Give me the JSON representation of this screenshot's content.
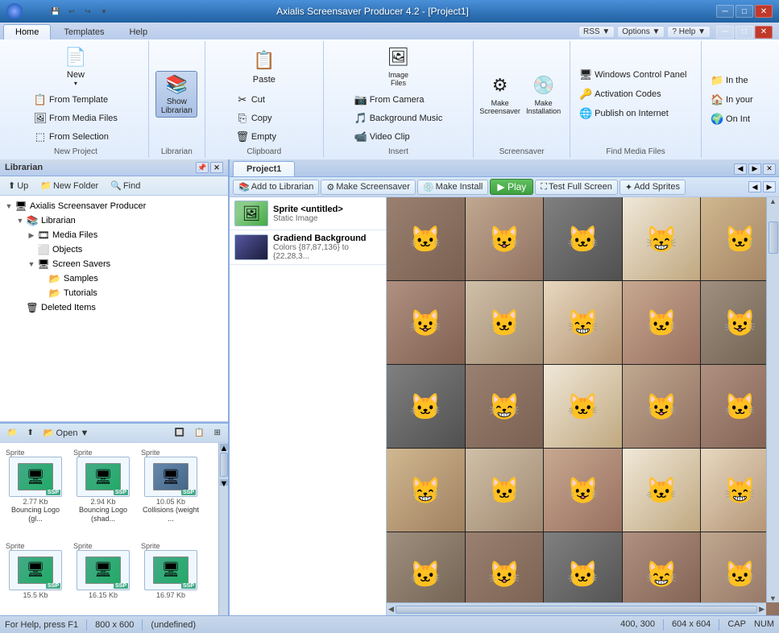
{
  "app": {
    "title": "Axialis Screensaver Producer 4.2 - [Project1]",
    "icon": "●"
  },
  "titlebar": {
    "minimize": "─",
    "restore": "□",
    "close": "✕",
    "title": "Axialis Screensaver Producer 4.2 - [Project1]"
  },
  "quick_toolbar": {
    "buttons": [
      "💾",
      "↩",
      "↪"
    ]
  },
  "ribbon": {
    "tabs": [
      "Home",
      "Templates",
      "Help"
    ],
    "active_tab": "Home",
    "groups": {
      "new_project": {
        "label": "New Project",
        "new_label": "New",
        "from_template": "From Template",
        "from_media": "From Media Files",
        "from_selection": "From Selection"
      },
      "librarian": {
        "label": "Librarian",
        "show_librarian": "Show\nLibrarian"
      },
      "clipboard": {
        "label": "Clipboard",
        "paste": "Paste",
        "cut": "Cut",
        "copy": "Copy",
        "empty": "Empty"
      },
      "insert": {
        "label": "Insert",
        "image_files": "Image\nFiles",
        "from_camera": "From Camera",
        "background_music": "Background Music",
        "video_clip": "Video Clip"
      },
      "make": {
        "label": "Screensaver",
        "make_screensaver": "Make\nScreensaver",
        "make_installation": "Make\nInstallation"
      },
      "find_media": {
        "label": "Find Media Files",
        "windows_control_panel": "Windows Control Panel",
        "activation_codes": "Activation Codes",
        "publish_on_internet": "Publish on Internet",
        "in_the": "In the",
        "in_your": "In your",
        "on_int": "On Int"
      }
    }
  },
  "top_extra": {
    "rss": "RSS ▼",
    "options": "Options ▼",
    "help": "? Help ▼",
    "min": "─",
    "restore": "□",
    "close": "✕"
  },
  "librarian_panel": {
    "title": "Librarian",
    "up_label": "Up",
    "new_folder_label": "New Folder",
    "find_label": "Find",
    "tree": {
      "root": "Axialis Screensaver Producer",
      "children": [
        {
          "label": "Librarian",
          "expanded": true,
          "children": [
            {
              "label": "Media Files",
              "children": []
            },
            {
              "label": "Objects",
              "children": []
            },
            {
              "label": "Screen Savers",
              "expanded": true,
              "children": [
                {
                  "label": "Samples",
                  "children": []
                },
                {
                  "label": "Tutorials",
                  "children": []
                }
              ]
            }
          ]
        },
        {
          "label": "Deleted Items",
          "children": []
        }
      ]
    }
  },
  "files_panel": {
    "buttons": [
      "📁",
      "🔼",
      "📂 Open ▼",
      "🔲",
      "📋",
      "⊞"
    ],
    "open_label": "Open ▼",
    "items": [
      {
        "type": "Sprite",
        "size": "2.77 Kb",
        "name": "Bouncing Logo (gl...",
        "badge": "SSP"
      },
      {
        "type": "Sprite",
        "size": "2.94 Kb",
        "name": "Bouncing Logo (shad...",
        "badge": "SSP"
      },
      {
        "type": "Sprite",
        "size": "10.05 Kb",
        "name": "Collisions (weight ...",
        "badge": "SSP"
      },
      {
        "type": "Sprite",
        "size": "15.5 Kb",
        "name": "",
        "badge": "SSP"
      },
      {
        "type": "Sprite",
        "size": "16.15 Kb",
        "name": "",
        "badge": "SSP"
      },
      {
        "type": "Sprite",
        "size": "16.97 Kb",
        "name": "",
        "badge": "SSP"
      }
    ]
  },
  "project": {
    "tab_name": "Project1",
    "toolbar": {
      "add_to_librarian": "Add to Librarian",
      "make_screensaver": "Make Screensaver",
      "make_install": "Make Install",
      "play": "▶ Play",
      "test_full_screen": "Test Full Screen",
      "add_sprites": "Add Sprites"
    },
    "sprites": [
      {
        "name": "Sprite <untitled>",
        "type": "Static Image",
        "thumb_type": "image"
      },
      {
        "name": "Gradiend Background",
        "type": "Colors {87,87,136} to {22,28,3...",
        "thumb_type": "gradient"
      }
    ]
  },
  "statusbar": {
    "help": "For Help, press F1",
    "dimensions": "800 x 600",
    "undefined": "(undefined)",
    "coords": "400, 300",
    "size2": "604 x 604",
    "caps": "CAP",
    "num": "NUM"
  },
  "colors": {
    "accent": "#3070c0",
    "background": "#d4e4f4",
    "panel_bg": "#e8f0f8"
  }
}
